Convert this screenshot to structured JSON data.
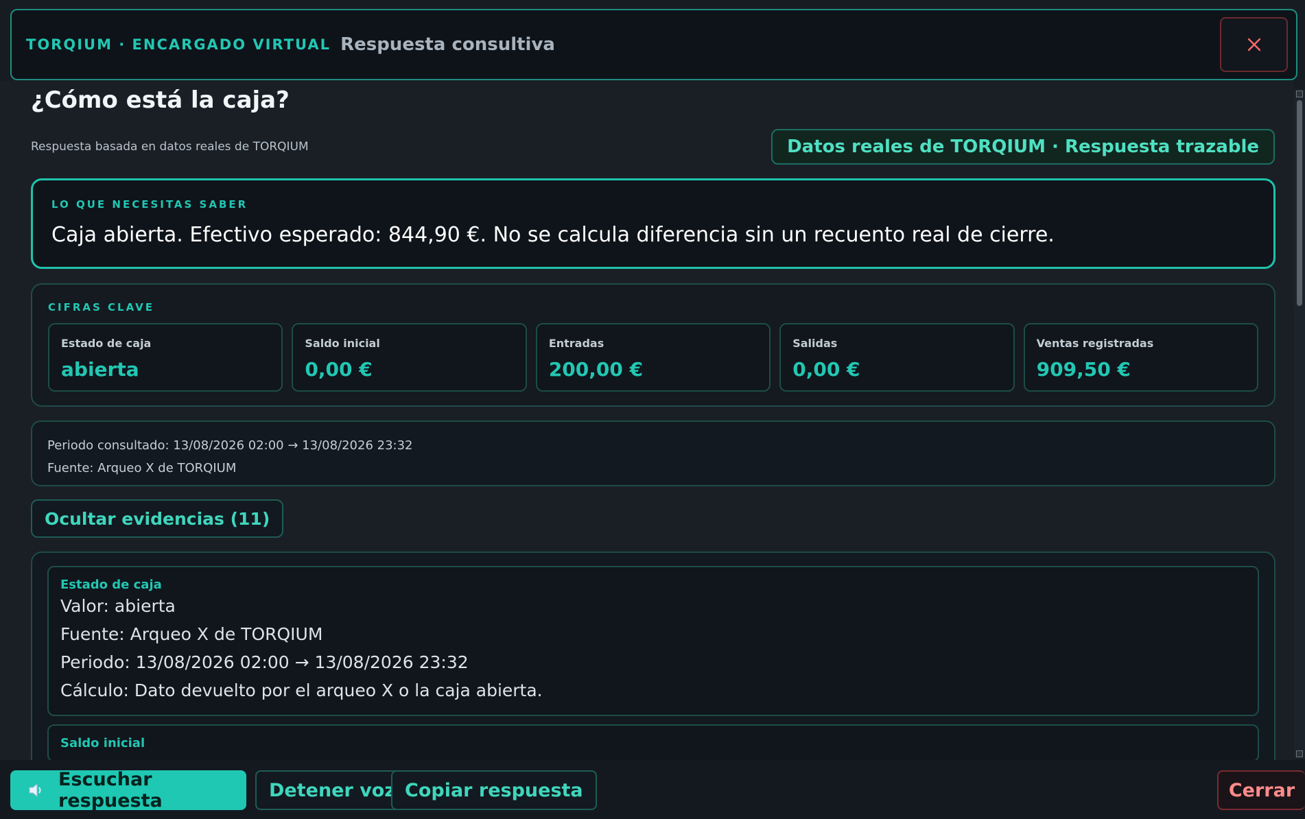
{
  "header": {
    "brand": "TORQIUM · ENCARGADO VIRTUAL",
    "subtitle": "Respuesta consultiva",
    "close_icon": "close-icon",
    "close_color": "#ff6b6b"
  },
  "main": {
    "question": "¿Cómo está la caja?",
    "basis": "Respuesta basada en datos reales de TORQIUM",
    "trace_badge": "Datos reales de TORQIUM · Respuesta trazable",
    "summary": {
      "label": "LO QUE NECESITAS SABER",
      "text": "Caja abierta. Efectivo esperado: 844,90 €. No se calcula diferencia sin un recuento real de cierre."
    },
    "figures": {
      "label": "CIFRAS CLAVE",
      "cards": [
        {
          "label": "Estado de caja",
          "value": "abierta"
        },
        {
          "label": "Saldo inicial",
          "value": "0,00 €"
        },
        {
          "label": "Entradas",
          "value": "200,00 €"
        },
        {
          "label": "Salidas",
          "value": "0,00 €"
        },
        {
          "label": "Ventas registradas",
          "value": "909,50 €"
        }
      ]
    },
    "period": {
      "line1": "Periodo consultado: 13/08/2026 02:00 → 13/08/2026 23:32",
      "line2": "Fuente: Arqueo X de TORQIUM"
    },
    "evidence_toggle": "Ocultar evidencias (11)",
    "evidence": [
      {
        "title": "Estado de caja",
        "value": "Valor: abierta",
        "source": "Fuente: Arqueo X de TORQIUM",
        "period": "Periodo: 13/08/2026 02:00 → 13/08/2026 23:32",
        "calc": "Cálculo: Dato devuelto por el arqueo X o la caja abierta."
      },
      {
        "title": "Saldo inicial"
      }
    ]
  },
  "footer": {
    "listen": "Escuchar respuesta",
    "speaker_icon": "speaker-icon",
    "stop": "Detener voz",
    "copy": "Copiar respuesta",
    "close": "Cerrar"
  },
  "colors": {
    "accent": "#22c7b3",
    "background": "#171c23",
    "danger": "#ff8b8b"
  }
}
